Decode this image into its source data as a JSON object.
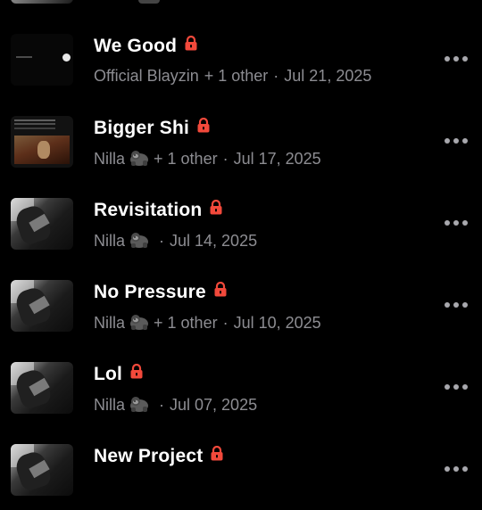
{
  "rows": [
    {
      "title": "We Good",
      "artist": "Official Blayzin",
      "artist_emoji": "",
      "others": "+ 1 other",
      "date": "Jul 21, 2025",
      "thumb": "dark"
    },
    {
      "title": "Bigger Shi",
      "artist": "Nilla",
      "artist_emoji": "gorilla-emoji",
      "others": "+ 1 other",
      "date": "Jul 17, 2025",
      "thumb": "frame"
    },
    {
      "title": "Revisitation",
      "artist": "Nilla",
      "artist_emoji": "gorilla-emoji",
      "others": "",
      "date": "Jul 14, 2025",
      "thumb": "photo"
    },
    {
      "title": "No Pressure",
      "artist": "Nilla",
      "artist_emoji": "gorilla-emoji",
      "others": "+ 1 other",
      "date": "Jul 10, 2025",
      "thumb": "photo"
    },
    {
      "title": "Lol",
      "artist": "Nilla",
      "artist_emoji": "gorilla-emoji",
      "others": "",
      "date": "Jul 07, 2025",
      "thumb": "photo"
    },
    {
      "title": "New Project",
      "artist": "",
      "artist_emoji": "",
      "others": "",
      "date": "",
      "thumb": "photo"
    }
  ],
  "separator": "·",
  "icons": {
    "lock": "lock-icon",
    "more": "more-horizontal-icon"
  },
  "colors": {
    "background": "#000000",
    "title": "#ffffff",
    "meta": "#8d8d92",
    "lock": "#f2493b",
    "more": "#a8a8ad"
  }
}
